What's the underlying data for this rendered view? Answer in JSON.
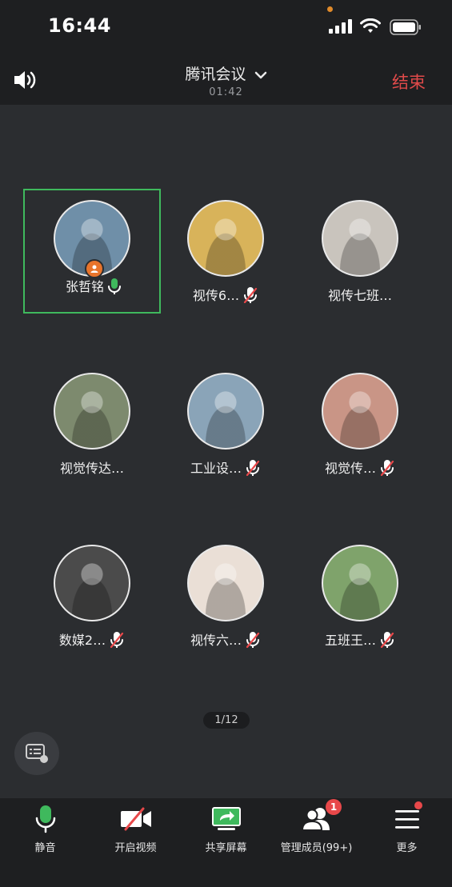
{
  "status_bar": {
    "time": "16:44"
  },
  "header": {
    "title": "腾讯会议",
    "duration": "01:42",
    "end_label": "结束"
  },
  "participants": [
    {
      "name": "张哲铭",
      "mic": "on",
      "host": true,
      "active": true,
      "avatar_color": "#6f8fa8"
    },
    {
      "name": "视传6…",
      "mic": "muted",
      "avatar_color": "#d8b35a"
    },
    {
      "name": "视传七班…",
      "mic": "none",
      "avatar_color": "#c9c4bd"
    },
    {
      "name": "视觉传达…",
      "mic": "none",
      "avatar_color": "#7d8a6e"
    },
    {
      "name": "工业设…",
      "mic": "muted",
      "avatar_color": "#8aa4b8"
    },
    {
      "name": "视觉传…",
      "mic": "muted",
      "avatar_color": "#c99586"
    },
    {
      "name": "数媒2…",
      "mic": "muted",
      "avatar_color": "#4b4b4b"
    },
    {
      "name": "视传六…",
      "mic": "muted",
      "avatar_color": "#eadfd6"
    },
    {
      "name": "五班王…",
      "mic": "muted",
      "avatar_color": "#7fa36b"
    }
  ],
  "pager": "1/12",
  "toolbar": {
    "mute_label": "静音",
    "video_label": "开启视频",
    "share_label": "共享屏幕",
    "members_label": "管理成员(99+)",
    "members_badge": "1",
    "more_label": "更多"
  },
  "colors": {
    "accent_green": "#3fb95d",
    "end_red": "#e04a4a",
    "badge_red": "#e8484a"
  },
  "icons": [
    "speaker-icon",
    "chevron-down-icon",
    "mic-icon",
    "mic-muted-icon",
    "camera-off-icon",
    "share-screen-icon",
    "members-icon",
    "menu-icon",
    "chat-icon",
    "host-icon"
  ]
}
